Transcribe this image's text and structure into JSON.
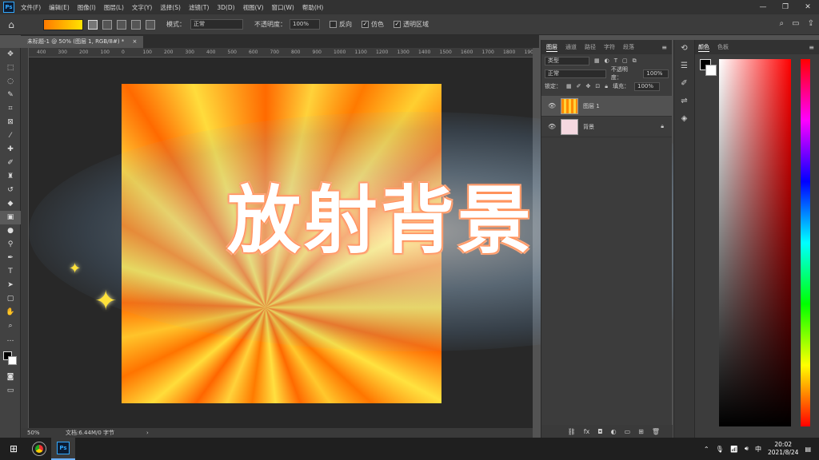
{
  "menubar": {
    "logo": "Ps",
    "items": [
      "文件(F)",
      "编辑(E)",
      "图像(I)",
      "图层(L)",
      "文字(Y)",
      "选择(S)",
      "滤镜(T)",
      "3D(D)",
      "视图(V)",
      "窗口(W)",
      "帮助(H)"
    ],
    "win_min": "—",
    "win_max": "❐",
    "win_close": "✕"
  },
  "options": {
    "mode_label": "模式：",
    "mode_value": "正常",
    "opacity_label": "不透明度：",
    "opacity_value": "100%",
    "reverse_label": "反向",
    "dither_label": "仿色",
    "transparency_label": "透明区域"
  },
  "document": {
    "tab_title": "未标题-1 @ 50% (图层 1, RGB/8#) *",
    "tab_close": "×"
  },
  "ruler_ticks": [
    "400",
    "300",
    "200",
    "100",
    "0",
    "100",
    "200",
    "300",
    "400",
    "500",
    "600",
    "700",
    "800",
    "900",
    "1000",
    "1100",
    "1200",
    "1300",
    "1400",
    "1500",
    "1600",
    "1700",
    "1800",
    "1900"
  ],
  "canvas": {
    "title_text": "放射背景"
  },
  "status": {
    "zoom": "50%",
    "doc_info": "文档:6.44M/0 字节",
    "arrow": "›"
  },
  "layers_panel": {
    "tabs": [
      "图层",
      "通道",
      "路径",
      "字符",
      "段落"
    ],
    "filter_label": "类型",
    "blend_mode": "正常",
    "opacity_label": "不透明度：",
    "opacity_value": "100%",
    "lock_label": "锁定：",
    "fill_label": "填充：",
    "fill_value": "100%",
    "layers": [
      {
        "name": "图层 1"
      },
      {
        "name": "背景"
      }
    ]
  },
  "color_panel": {
    "tabs": [
      "颜色",
      "色板"
    ]
  },
  "taskbar": {
    "ime": "中",
    "time": "20:02",
    "date": "2021/8/24"
  },
  "colors": {
    "ps_blue": "#31a8ff",
    "ray_orange": "#ff6a00",
    "ray_yellow": "#ffd23a"
  }
}
